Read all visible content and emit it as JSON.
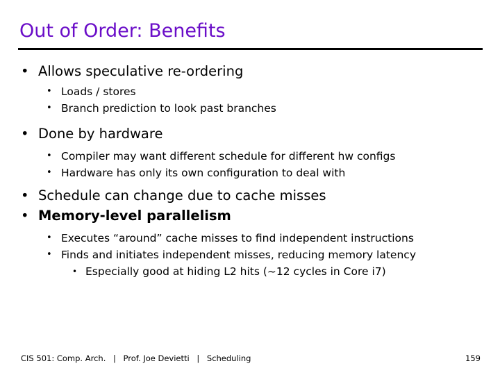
{
  "slide": {
    "title": "Out of Order: Benefits",
    "title_color": "#6a0dc8",
    "rule_color": "#000000",
    "background_color": "#ffffff",
    "bullet_glyph": "•",
    "content": [
      {
        "level": 1,
        "text": "Allows speculative re-ordering",
        "bold": false
      },
      {
        "level": 2,
        "text": "Loads / stores",
        "bold": false
      },
      {
        "level": 2,
        "text": "Branch prediction to look past branches",
        "bold": false
      },
      {
        "level": 1,
        "text": "Done by hardware",
        "bold": false
      },
      {
        "level": 2,
        "text": "Compiler may want different schedule for different hw configs",
        "bold": false
      },
      {
        "level": 2,
        "text": "Hardware has only its own configuration to deal with",
        "bold": false
      },
      {
        "level": 1,
        "text": "Schedule can change due to cache misses",
        "bold": false
      },
      {
        "level": 1,
        "text": "Memory-level parallelism",
        "bold": true
      },
      {
        "level": 2,
        "text": "Executes “around” cache misses to find independent instructions",
        "bold": false
      },
      {
        "level": 2,
        "text": "Finds and initiates independent misses, reducing memory latency",
        "bold": false
      },
      {
        "level": 3,
        "text": "Especially good at hiding L2 hits (~12 cycles in Core i7)",
        "bold": false
      }
    ]
  },
  "footer": {
    "course": "CIS 501: Comp. Arch.",
    "separator": "|",
    "instructor": "Prof. Joe Devietti",
    "topic": "Scheduling",
    "page_number": "159"
  }
}
